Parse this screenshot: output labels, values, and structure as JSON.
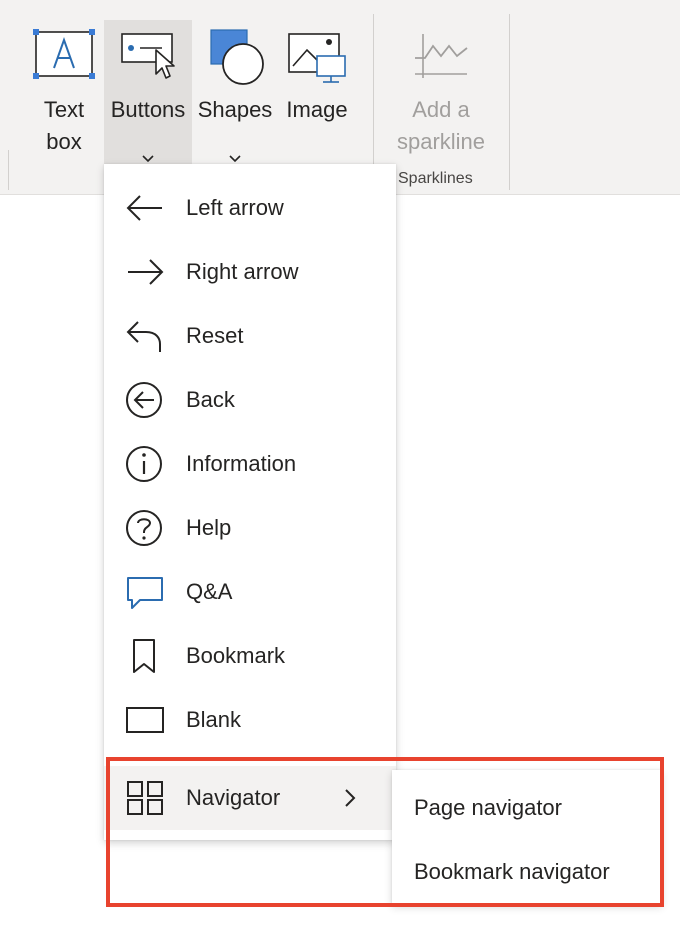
{
  "ribbon": {
    "buttons": [
      {
        "label_line1": "Text",
        "label_line2": "box",
        "icon": "text-box-icon"
      },
      {
        "label_line1": "Buttons",
        "label_line2": "",
        "icon": "buttons-icon",
        "expanded": true
      },
      {
        "label_line1": "Shapes",
        "label_line2": "",
        "icon": "shapes-icon"
      },
      {
        "label_line1": "Image",
        "label_line2": "",
        "icon": "image-icon"
      },
      {
        "label_line1": "Add a",
        "label_line2": "sparkline",
        "icon": "sparkline-icon",
        "disabled": true
      }
    ],
    "sparklines_group_label": "Sparklines"
  },
  "buttons_menu": {
    "items": [
      {
        "label": "Left arrow",
        "icon": "left-arrow-icon"
      },
      {
        "label": "Right arrow",
        "icon": "right-arrow-icon"
      },
      {
        "label": "Reset",
        "icon": "reset-icon"
      },
      {
        "label": "Back",
        "icon": "back-circle-icon"
      },
      {
        "label": "Information",
        "icon": "info-circle-icon"
      },
      {
        "label": "Help",
        "icon": "help-circle-icon"
      },
      {
        "label": "Q&A",
        "icon": "qa-bubble-icon"
      },
      {
        "label": "Bookmark",
        "icon": "bookmark-icon"
      },
      {
        "label": "Blank",
        "icon": "blank-rectangle-icon"
      },
      {
        "label": "Navigator",
        "icon": "navigator-grid-icon",
        "has_submenu": true
      }
    ]
  },
  "navigator_submenu": {
    "items": [
      {
        "label": "Page navigator"
      },
      {
        "label": "Bookmark navigator"
      }
    ]
  },
  "colors": {
    "ribbon_bg": "#f3f2f1",
    "accent_blue": "#2b6cb0",
    "highlight_red": "#e8432e",
    "disabled_text": "#a19f9d"
  }
}
